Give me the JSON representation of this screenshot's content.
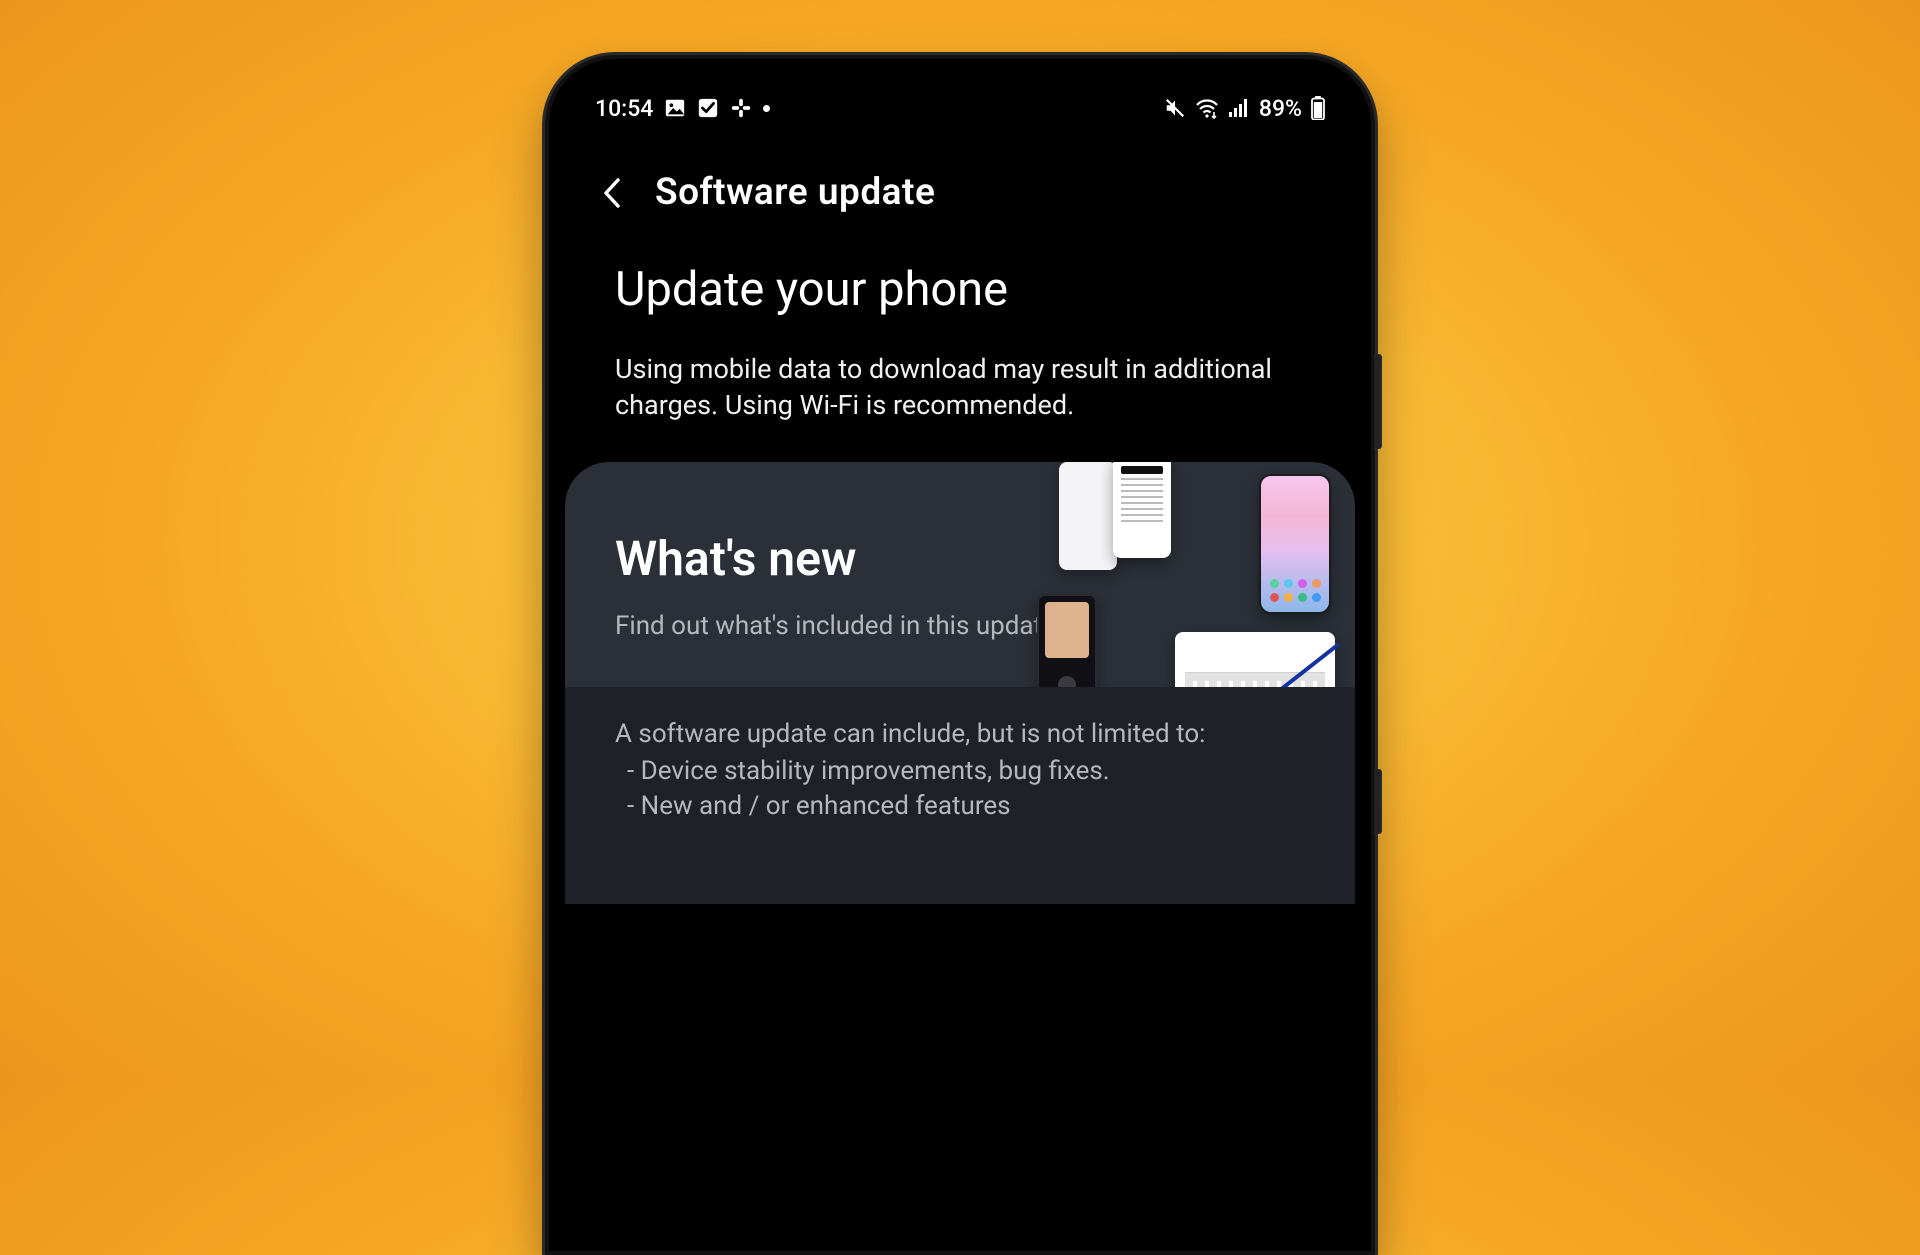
{
  "status": {
    "time": "10:54",
    "battery_pct": "89%"
  },
  "header": {
    "title": "Software update"
  },
  "main": {
    "heading": "Update your phone",
    "subtext": "Using mobile data to download may result in additional charges. Using Wi-Fi is recommended."
  },
  "whats_new": {
    "title": "What's new",
    "subtitle": "Find out what's included in this update."
  },
  "details": {
    "lead": "A software update can include, but is not limited to:",
    "items": [
      "Device stability improvements, bug fixes.",
      "New and / or enhanced features"
    ]
  },
  "icons": {
    "image": "image-icon",
    "check": "checkbox-icon",
    "slack": "slack-icon",
    "mute": "mute-icon",
    "wifi": "wifi-icon",
    "signal": "signal-icon",
    "battery": "battery-icon",
    "back": "back-icon"
  }
}
